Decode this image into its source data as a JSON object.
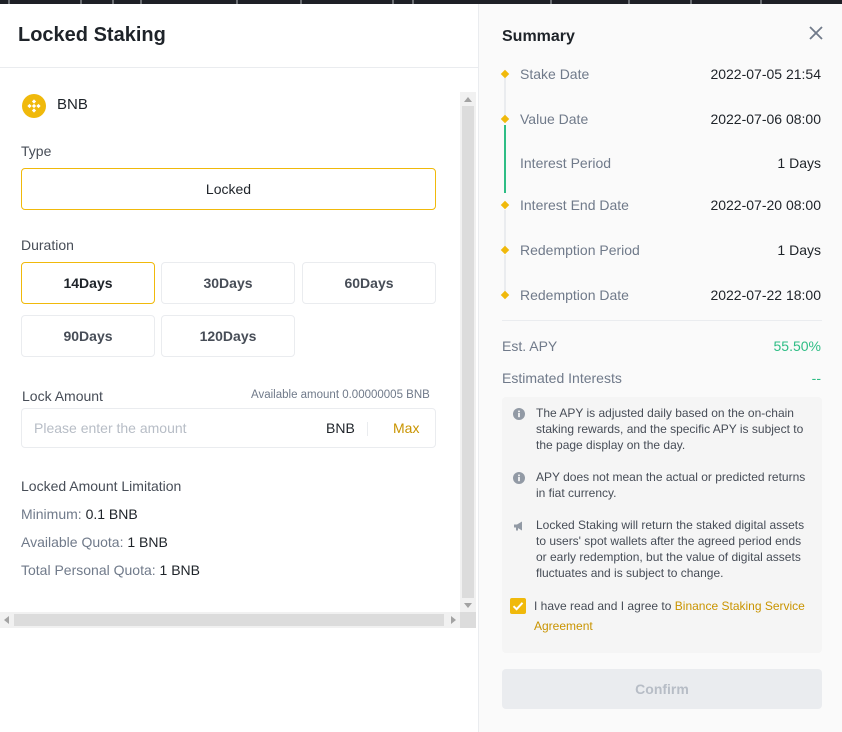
{
  "modal": {
    "title": "Locked Staking"
  },
  "asset": {
    "name": "BNB",
    "icon": "bnb-coin-icon",
    "color": "#f0b90b"
  },
  "type": {
    "label": "Type",
    "value": "Locked"
  },
  "duration": {
    "label": "Duration",
    "options": [
      "14Days",
      "30Days",
      "60Days",
      "90Days",
      "120Days"
    ],
    "selected": "14Days"
  },
  "lock_amount": {
    "label": "Lock Amount",
    "available": "Available amount 0.00000005 BNB",
    "placeholder": "Please enter the amount",
    "unit": "BNB",
    "max_label": "Max"
  },
  "limits": {
    "title": "Locked Amount Limitation",
    "minimum_label": "Minimum:",
    "minimum_value": "0.1 BNB",
    "available_quota_label": "Available Quota:",
    "available_quota_value": "1 BNB",
    "total_quota_label": "Total Personal Quota:",
    "total_quota_value": "1 BNB"
  },
  "summary": {
    "title": "Summary",
    "rows": [
      {
        "label": "Stake Date",
        "value": "2022-07-05 21:54"
      },
      {
        "label": "Value Date",
        "value": "2022-07-06 08:00"
      },
      {
        "label": "Interest Period",
        "value": "1 Days"
      },
      {
        "label": "Interest End Date",
        "value": "2022-07-20 08:00"
      },
      {
        "label": "Redemption Period",
        "value": "1 Days"
      },
      {
        "label": "Redemption Date",
        "value": "2022-07-22 18:00"
      }
    ],
    "est_apy_label": "Est. APY",
    "est_apy_value": "55.50%",
    "est_interest_label": "Estimated Interests",
    "est_interest_value": "--",
    "notes": [
      {
        "icon": "info-icon",
        "text": "The APY is adjusted daily based on the on-chain staking rewards, and the specific APY is subject to the page display on the day."
      },
      {
        "icon": "info-icon",
        "text": "APY does not mean the actual or predicted returns in fiat currency."
      },
      {
        "icon": "megaphone-icon",
        "text": "Locked Staking will return the staked digital assets to users' spot wallets after the agreed period ends or early redemption, but the value of digital assets fluctuates and is subject to change."
      }
    ],
    "agreement_prefix": "I have read and I agree to",
    "agreement_link": "Binance Staking Service Agreement",
    "agreement_checked": true,
    "confirm_label": "Confirm"
  },
  "colors": {
    "accent": "#f0b90b",
    "positive": "#2ebd85",
    "link": "#c99400"
  }
}
